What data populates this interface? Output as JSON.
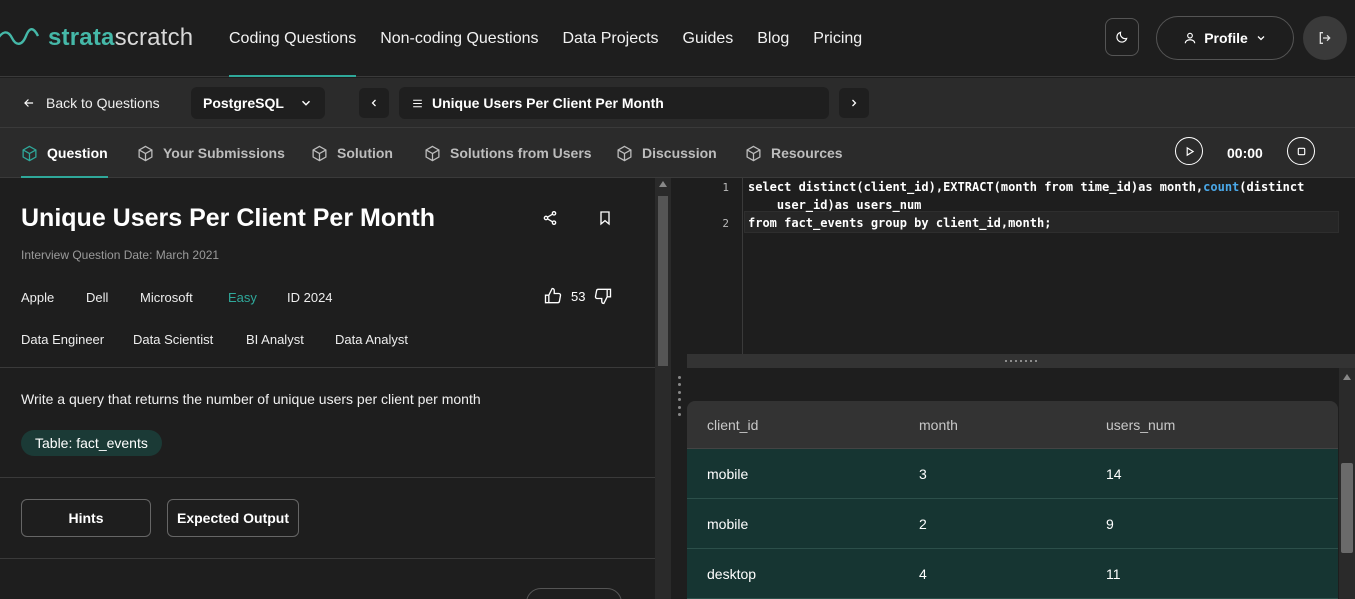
{
  "nav": {
    "logo_a": "strata",
    "logo_b": "scratch",
    "links": [
      "Coding Questions",
      "Non-coding Questions",
      "Data Projects",
      "Guides",
      "Blog",
      "Pricing"
    ],
    "profile_label": "Profile"
  },
  "subbar": {
    "back_label": "Back to Questions",
    "db_selected": "PostgreSQL",
    "question_selected": "Unique Users Per Client Per Month"
  },
  "tabs": [
    "Question",
    "Your Submissions",
    "Solution",
    "Solutions from Users",
    "Discussion",
    "Resources"
  ],
  "timer": "00:00",
  "question": {
    "title": "Unique Users Per Client Per Month",
    "date": "Interview Question Date: March 2021",
    "companies": [
      "Apple",
      "Dell",
      "Microsoft"
    ],
    "difficulty": "Easy",
    "id": "ID 2024",
    "likes": "53",
    "roles": [
      "Data Engineer",
      "Data Scientist",
      "BI Analyst",
      "Data Analyst"
    ],
    "description": "Write a query that returns the number of unique users per client per month",
    "table_chip": "Table: fact_events",
    "hints_label": "Hints",
    "expected_label": "Expected Output"
  },
  "editor": {
    "line_numbers": [
      "1",
      "2"
    ],
    "line1_a": "select distinct(client_id),EXTRACT(month from time_id)as month,",
    "line1_fn": "count",
    "line1_b": "(distinct",
    "line1_wrap": "    user_id)as users_num",
    "line2": "from fact_events group by client_id,month;"
  },
  "results": {
    "columns": [
      "client_id",
      "month",
      "users_num"
    ],
    "rows": [
      [
        "mobile",
        "3",
        "14"
      ],
      [
        "mobile",
        "2",
        "9"
      ],
      [
        "desktop",
        "4",
        "11"
      ]
    ]
  },
  "colors": {
    "accent": "#2fa89a",
    "background": "#1e1e1e",
    "result_row": "#163532"
  }
}
